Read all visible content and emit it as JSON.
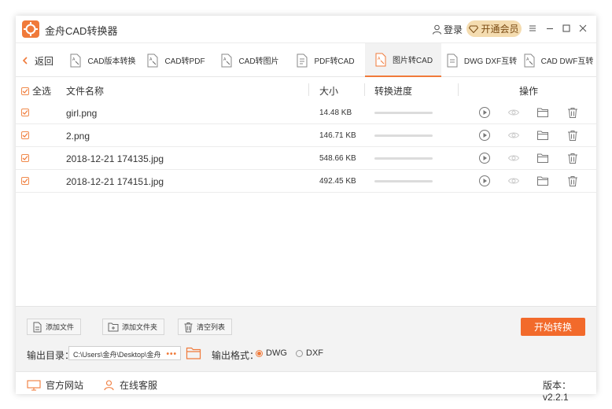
{
  "app": {
    "title": "金舟CAD转换器",
    "login_label": "登录",
    "vip_label": "开通会员"
  },
  "colors": {
    "accent": "#f07a3a",
    "start_button": "#f26a2b",
    "vip_bg": "#f4dcb0"
  },
  "nav": {
    "back_label": "返回",
    "tabs": [
      {
        "label": "CAD版本转换",
        "icon": "cad-version-icon"
      },
      {
        "label": "CAD转PDF",
        "icon": "cad-to-pdf-icon"
      },
      {
        "label": "CAD转图片",
        "icon": "cad-to-image-icon"
      },
      {
        "label": "PDF转CAD",
        "icon": "pdf-to-cad-icon"
      },
      {
        "label": "图片转CAD",
        "icon": "image-to-cad-icon",
        "active": true
      },
      {
        "label": "DWG DXF互转",
        "icon": "dwg-dxf-icon"
      },
      {
        "label": "CAD DWF互转",
        "icon": "cad-dwf-icon"
      }
    ]
  },
  "table": {
    "select_all": "全选",
    "headers": {
      "name": "文件名称",
      "size": "大小",
      "progress": "转换进度",
      "actions": "操作"
    },
    "rows": [
      {
        "name": "girl.png",
        "size": "14.48 KB",
        "progress": 0
      },
      {
        "name": "2.png",
        "size": "146.71 KB",
        "progress": 0
      },
      {
        "name": "2018-12-21 174135.jpg",
        "size": "548.66 KB",
        "progress": 0
      },
      {
        "name": "2018-12-21 174151.jpg",
        "size": "492.45 KB",
        "progress": 0
      }
    ]
  },
  "toolbar": {
    "add_file": "添加文件",
    "add_folder": "添加文件夹",
    "clear_list": "清空列表",
    "start": "开始转换"
  },
  "output": {
    "dir_label": "输出目录：",
    "dir_value": "C:\\Users\\金舟\\Desktop\\金舟",
    "more": "•••",
    "format_label": "输出格式：",
    "formats": [
      "DWG",
      "DXF"
    ],
    "selected_format": "DWG"
  },
  "status": {
    "website": "官方网站",
    "support": "在线客服",
    "version": "版本：v2.2.1"
  }
}
